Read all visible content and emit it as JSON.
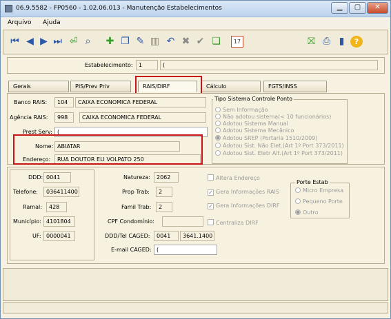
{
  "window": {
    "title": "06.9.5582 - FP0560 - 1.02.06.013 - Manutenção Estabelecimentos",
    "minimize_icon": "minimize-icon",
    "maximize_icon": "maximize-icon",
    "close_icon": "close-icon"
  },
  "menu": {
    "arquivo": "Arquivo",
    "ajuda": "Ajuda"
  },
  "toolbar_icons": [
    "first-icon",
    "prev-icon",
    "next-icon",
    "last-icon",
    "goto-icon",
    "search-icon",
    "new-icon",
    "copy-icon",
    "edit-icon",
    "delete-icon",
    "undo-icon",
    "cancel-icon",
    "confirm-icon",
    "blank-icon",
    "calendar-icon",
    "tree-icon",
    "print-icon",
    "exit-icon",
    "help-icon"
  ],
  "calendar_day": "17",
  "estabelecimento": {
    "label": "Estabelecimento:",
    "code": "1",
    "name": "("
  },
  "tabs": [
    "Gerais",
    "PIS/Prev Priv",
    "RAIS/DIRF",
    "Cálculo",
    "FGTS/INSS"
  ],
  "rais": {
    "banco_label": "Banco RAIS:",
    "banco_code": "104",
    "banco_name": "CAIXA ECONOMICA FEDERAL",
    "agencia_label": "Agência RAIS:",
    "agencia_code": "998",
    "agencia_name": "CAIXA ECONOMICA FEDERAL",
    "prest_label": "Prest Serv:",
    "prest_value": "(",
    "nome_label": "Nome:",
    "nome_value": "ABIATAR",
    "endereco_label": "Endereço:",
    "endereco_value": "RUA DOUTOR ELI VOLPATO 250"
  },
  "ponto": {
    "title": "Tipo Sistema Controle Ponto",
    "options": [
      "Sem Informação",
      "Não adotou sistema(< 10 funcionários)",
      "Adotou Sistema Manual",
      "Adotou Sistema Mecânico",
      "Adotou SREP (Portaria 1510/2009)",
      "Adotou Sist. Não Elet.(Art 1º Port 373/2011)",
      "Adotou Sist. Eletr Alt.(Art 1º Port 373/2011)"
    ],
    "selected": "Adotou SREP (Portaria 1510/2009)"
  },
  "contato": {
    "ddd_label": "DDD:",
    "ddd": "0041",
    "telefone_label": "Telefone:",
    "telefone": "036411400",
    "ramal_label": "Ramal:",
    "ramal": "428",
    "municipio_label": "Município:",
    "municipio": "4101804",
    "uf_label": "UF:",
    "uf": "0000041"
  },
  "info": {
    "natureza_label": "Natureza:",
    "natureza": "2062",
    "prop_label": "Prop Trab:",
    "prop": "2",
    "famil_label": "Famil Trab:",
    "famil": "2",
    "cpf_label": "CPF Condomínio:",
    "cpf": "",
    "caged_label": "DDD/Tel CAGED:",
    "caged_ddd": "0041",
    "caged_tel": "3641.1400",
    "email_label": "E-mail CAGED:",
    "email": "("
  },
  "checks": {
    "altera_endereco": "Altera Endereço",
    "gera_rais": "Gera Informações RAIS",
    "gera_dirf": "Gera Informações DIRF",
    "centraliza_dirf": "Centraliza DIRF",
    "check_mark": "✓"
  },
  "porte": {
    "title": "Porte Estab",
    "options": [
      "Micro Empresa",
      "Pequeno Porte",
      "Outro"
    ],
    "selected": "Outro"
  }
}
